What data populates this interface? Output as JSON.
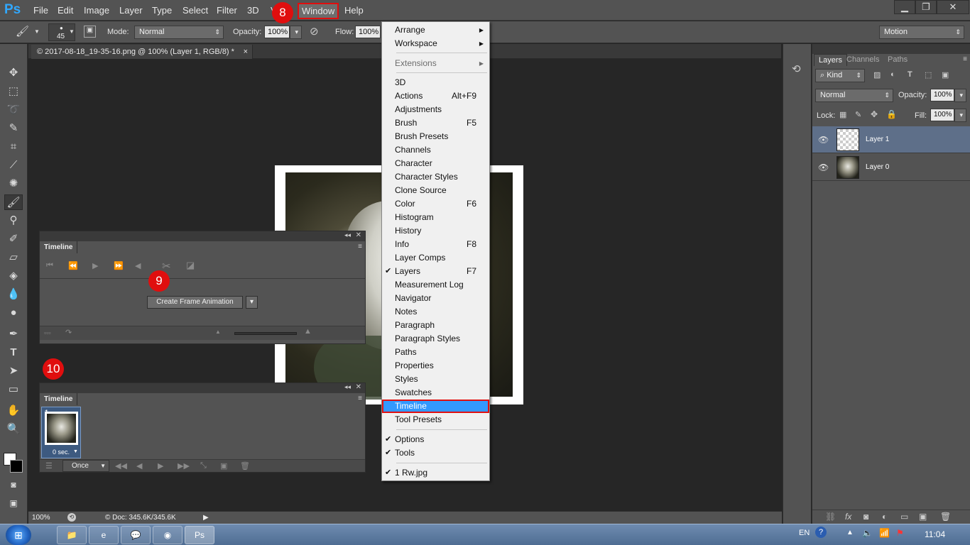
{
  "app": {
    "logo": "Ps"
  },
  "menubar": {
    "items": [
      "File",
      "Edit",
      "Image",
      "Layer",
      "Type",
      "Select",
      "Filter",
      "3D",
      "V",
      "Window",
      "Help"
    ],
    "window_controls": {
      "minimize": "▁",
      "restore": "❐",
      "close": "✕"
    }
  },
  "options_bar": {
    "brush_size": "45",
    "mode_label": "Mode:",
    "mode_value": "Normal",
    "opacity_label": "Opacity:",
    "opacity_value": "100%",
    "flow_label": "Flow:",
    "flow_value": "100%",
    "workspace_value": "Motion"
  },
  "document": {
    "tab_title": "© 2017-08-18_19-35-16.png @ 100% (Layer 1, RGB/8) *",
    "tab_close": "×"
  },
  "status": {
    "zoom": "100%",
    "doc_info": "© Doc: 345.6K/345.6K",
    "arrow": "▶"
  },
  "layers_panel": {
    "tabs": [
      "Layers",
      "Channels",
      "Paths"
    ],
    "filter_kind": "Kind",
    "blend_mode": "Normal",
    "opacity_label": "Opacity:",
    "opacity_value": "100%",
    "lock_label": "Lock:",
    "fill_label": "Fill:",
    "fill_value": "100%",
    "layers": [
      {
        "name": "Layer 1",
        "selected": true
      },
      {
        "name": "Layer 0",
        "selected": false
      }
    ]
  },
  "timeline_top": {
    "tab": "Timeline",
    "create_button": "Create Frame Animation"
  },
  "timeline_bottom": {
    "tab": "Timeline",
    "frame_number": "1",
    "frame_delay": "0 sec.",
    "loop": "Once"
  },
  "badges": {
    "b8": "8",
    "b9": "9",
    "b10": "10"
  },
  "window_menu": {
    "groups": {
      "top": [
        {
          "label": "Arrange",
          "submenu": true
        },
        {
          "label": "Workspace",
          "submenu": true
        }
      ],
      "ext": [
        {
          "label": "Extensions",
          "submenu": true,
          "disabled": true
        }
      ],
      "panels": [
        {
          "label": "3D"
        },
        {
          "label": "Actions",
          "shortcut": "Alt+F9"
        },
        {
          "label": "Adjustments"
        },
        {
          "label": "Brush",
          "shortcut": "F5"
        },
        {
          "label": "Brush Presets"
        },
        {
          "label": "Channels"
        },
        {
          "label": "Character"
        },
        {
          "label": "Character Styles"
        },
        {
          "label": "Clone Source"
        },
        {
          "label": "Color",
          "shortcut": "F6"
        },
        {
          "label": "Histogram"
        },
        {
          "label": "History"
        },
        {
          "label": "Info",
          "shortcut": "F8"
        },
        {
          "label": "Layer Comps"
        },
        {
          "label": "Layers",
          "shortcut": "F7",
          "checked": true
        },
        {
          "label": "Measurement Log"
        },
        {
          "label": "Navigator"
        },
        {
          "label": "Notes"
        },
        {
          "label": "Paragraph"
        },
        {
          "label": "Paragraph Styles"
        },
        {
          "label": "Paths"
        },
        {
          "label": "Properties"
        },
        {
          "label": "Styles"
        },
        {
          "label": "Swatches"
        },
        {
          "label": "Timeline",
          "highlighted": true
        },
        {
          "label": "Tool Presets"
        }
      ],
      "bars": [
        {
          "label": "Options",
          "checked": true
        },
        {
          "label": "Tools",
          "checked": true
        }
      ],
      "docs": [
        {
          "label": "1 Rw.jpg",
          "checked": true
        }
      ]
    }
  },
  "taskbar": {
    "lang": "EN",
    "time": "11:04"
  },
  "colors": {
    "highlight": "#3399ff",
    "callout": "#e00e0e",
    "panel": "#535353"
  }
}
